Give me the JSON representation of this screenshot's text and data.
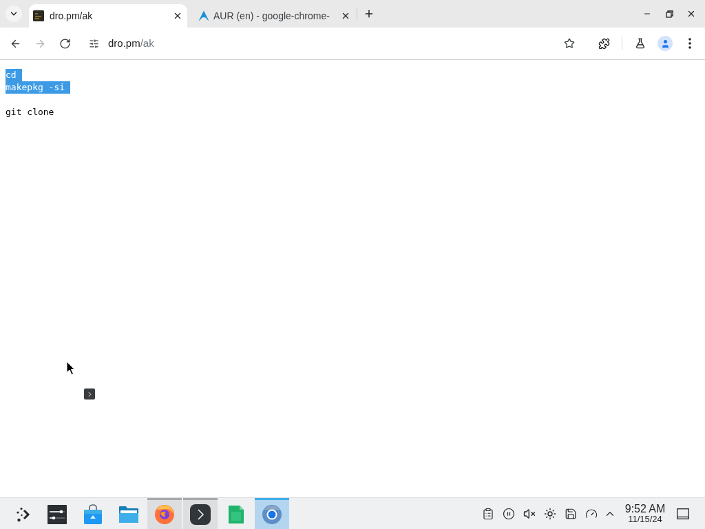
{
  "browser": {
    "tabs": [
      {
        "title": "dro.pm/ak",
        "favicon": {
          "kind": "terminal"
        },
        "selected": true
      },
      {
        "title": "AUR (en) - google-chrome-",
        "favicon": {
          "kind": "arch"
        },
        "selected": false
      }
    ],
    "nav_buttons": [
      {
        "kind": "back",
        "disabled": false
      },
      {
        "kind": "forward",
        "disabled": true
      },
      {
        "kind": "reload",
        "disabled": false
      }
    ],
    "address": {
      "host": "dro.pm",
      "path": "/ak"
    },
    "bookmarked": false
  },
  "page": {
    "blocks": [
      {
        "lines": [
          {
            "text": "cd",
            "selected": true
          },
          {
            "text": "makepkg -si",
            "selected": true
          }
        ]
      },
      {
        "lines": [
          {
            "text": "git clone",
            "selected": false
          }
        ]
      }
    ]
  },
  "taskbar": {
    "apps": [
      {
        "kind": "launcher",
        "running": false,
        "active": false
      },
      {
        "kind": "settings",
        "running": false,
        "active": false
      },
      {
        "kind": "discover",
        "running": false,
        "active": false
      },
      {
        "kind": "files",
        "running": false,
        "active": false
      },
      {
        "kind": "firefox",
        "running": true,
        "active": false
      },
      {
        "kind": "konsole",
        "running": true,
        "active": false
      },
      {
        "kind": "calc",
        "running": false,
        "active": false
      },
      {
        "kind": "chrome",
        "running": true,
        "active": true
      }
    ],
    "tray": {
      "muted": true
    },
    "clock": {
      "time": "9:52 AM",
      "date": "11/15/24"
    }
  }
}
